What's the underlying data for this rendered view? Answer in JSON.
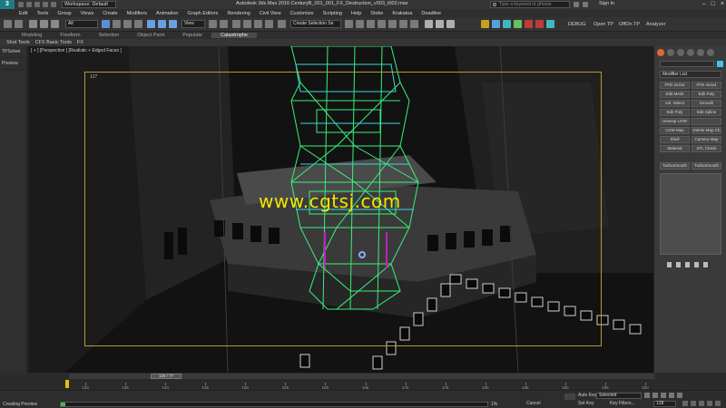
{
  "titlebar": {
    "workspace": "Workspace: Default",
    "title": "Autodesk 3ds Max 2016    CenturyB_001_001_FX_Destruction_v003_t002.max",
    "search_placeholder": "Type a keyword or phrase",
    "signin": "Sign In",
    "logo": "3"
  },
  "menu": [
    "Edit",
    "Tools",
    "Group",
    "Views",
    "Create",
    "Modifiers",
    "Animation",
    "Graph Editors",
    "Rendering",
    "Civil View",
    "Customize",
    "Scripting",
    "Help",
    "Stoke",
    "Krakatoa",
    "Deadline"
  ],
  "toolbar": {
    "filter": "All",
    "view": "View",
    "selection_set": "Create Selection Se",
    "right_labels": [
      "DEBUG",
      "Open TP",
      "OffOn TP",
      "Analyzer"
    ]
  },
  "ribbon": {
    "tabs": [
      "Modeling",
      "Freeform",
      "Selection",
      "Object Paint",
      "Populate",
      "Catastrophe"
    ],
    "active": "Catastrophe",
    "subtabs": [
      "Shot Tools",
      "CFX Basic Tools",
      "FX"
    ]
  },
  "leftpanel": [
    "TPSolver",
    "Preview"
  ],
  "viewport": {
    "label": "[ + ] [Perspective ] [Realistic + Edged Faces ]",
    "frame_number": "127",
    "watermark": "www.cgtsj.com"
  },
  "cmdpanel": {
    "modifier_list": "Modifier List",
    "buttons": [
      "FFD 2x2x2",
      "FFD 4x4x4",
      "Edit Mesh",
      "Edit Poly",
      "Vol. Select",
      "Smooth",
      "Edit Poly",
      "Edit Spline",
      "Unwrap UVW",
      "",
      "UVW Map",
      "Delete Map Ch",
      "Shell",
      "Camera Map",
      "Material",
      "STL Check"
    ],
    "buttons2": [
      "TurboSmooth",
      "TurboSmooth"
    ],
    "swatch_color": "#38c8e6"
  },
  "timeline": {
    "thumb": "128 / 77",
    "ticks": [
      "130",
      "135",
      "140",
      "145",
      "150",
      "155",
      "160",
      "165",
      "170",
      "175",
      "180",
      "185",
      "190",
      "195",
      "200"
    ]
  },
  "statusbar": {
    "caption": "Creating Preview",
    "progress": 0.01,
    "percent": "1%",
    "cancel": "Cancel",
    "auto_key": "Auto Key",
    "selected": "Selected",
    "set_key": "Set Key",
    "key_filters": "Key Filters...",
    "frame": "128"
  }
}
